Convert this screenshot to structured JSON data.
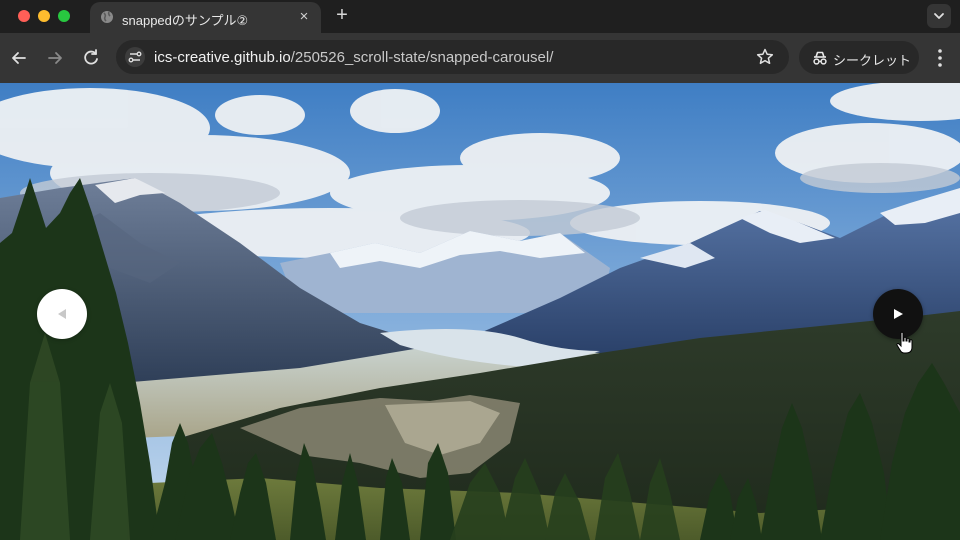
{
  "browser": {
    "tab": {
      "title": "snappedのサンプル②",
      "close_glyph": "×",
      "active": true
    },
    "new_tab_glyph": "+",
    "address": {
      "host": "ics-creative.github.io",
      "path": "/250526_scroll-state/snapped-carousel/"
    },
    "incognito_label": "シークレット",
    "icons": [
      "back-icon",
      "forward-icon",
      "reload-icon",
      "site-info-icon",
      "bookmark-star-icon",
      "incognito-icon",
      "more-menu-icon",
      "tab-search-chevron-icon",
      "globe-icon"
    ]
  },
  "carousel": {
    "slide": {
      "description": "mountain landscape photo"
    },
    "prev_button": {
      "icon": "triangle-left-icon",
      "enabled": false
    },
    "next_button": {
      "icon": "triangle-right-icon",
      "enabled": true
    }
  },
  "colors": {
    "chrome_dark": "#1f1f1f",
    "toolbar": "#353535",
    "omnibox": "#282828",
    "prev_button_bg": "#ffffff",
    "next_button_bg": "#111111"
  }
}
